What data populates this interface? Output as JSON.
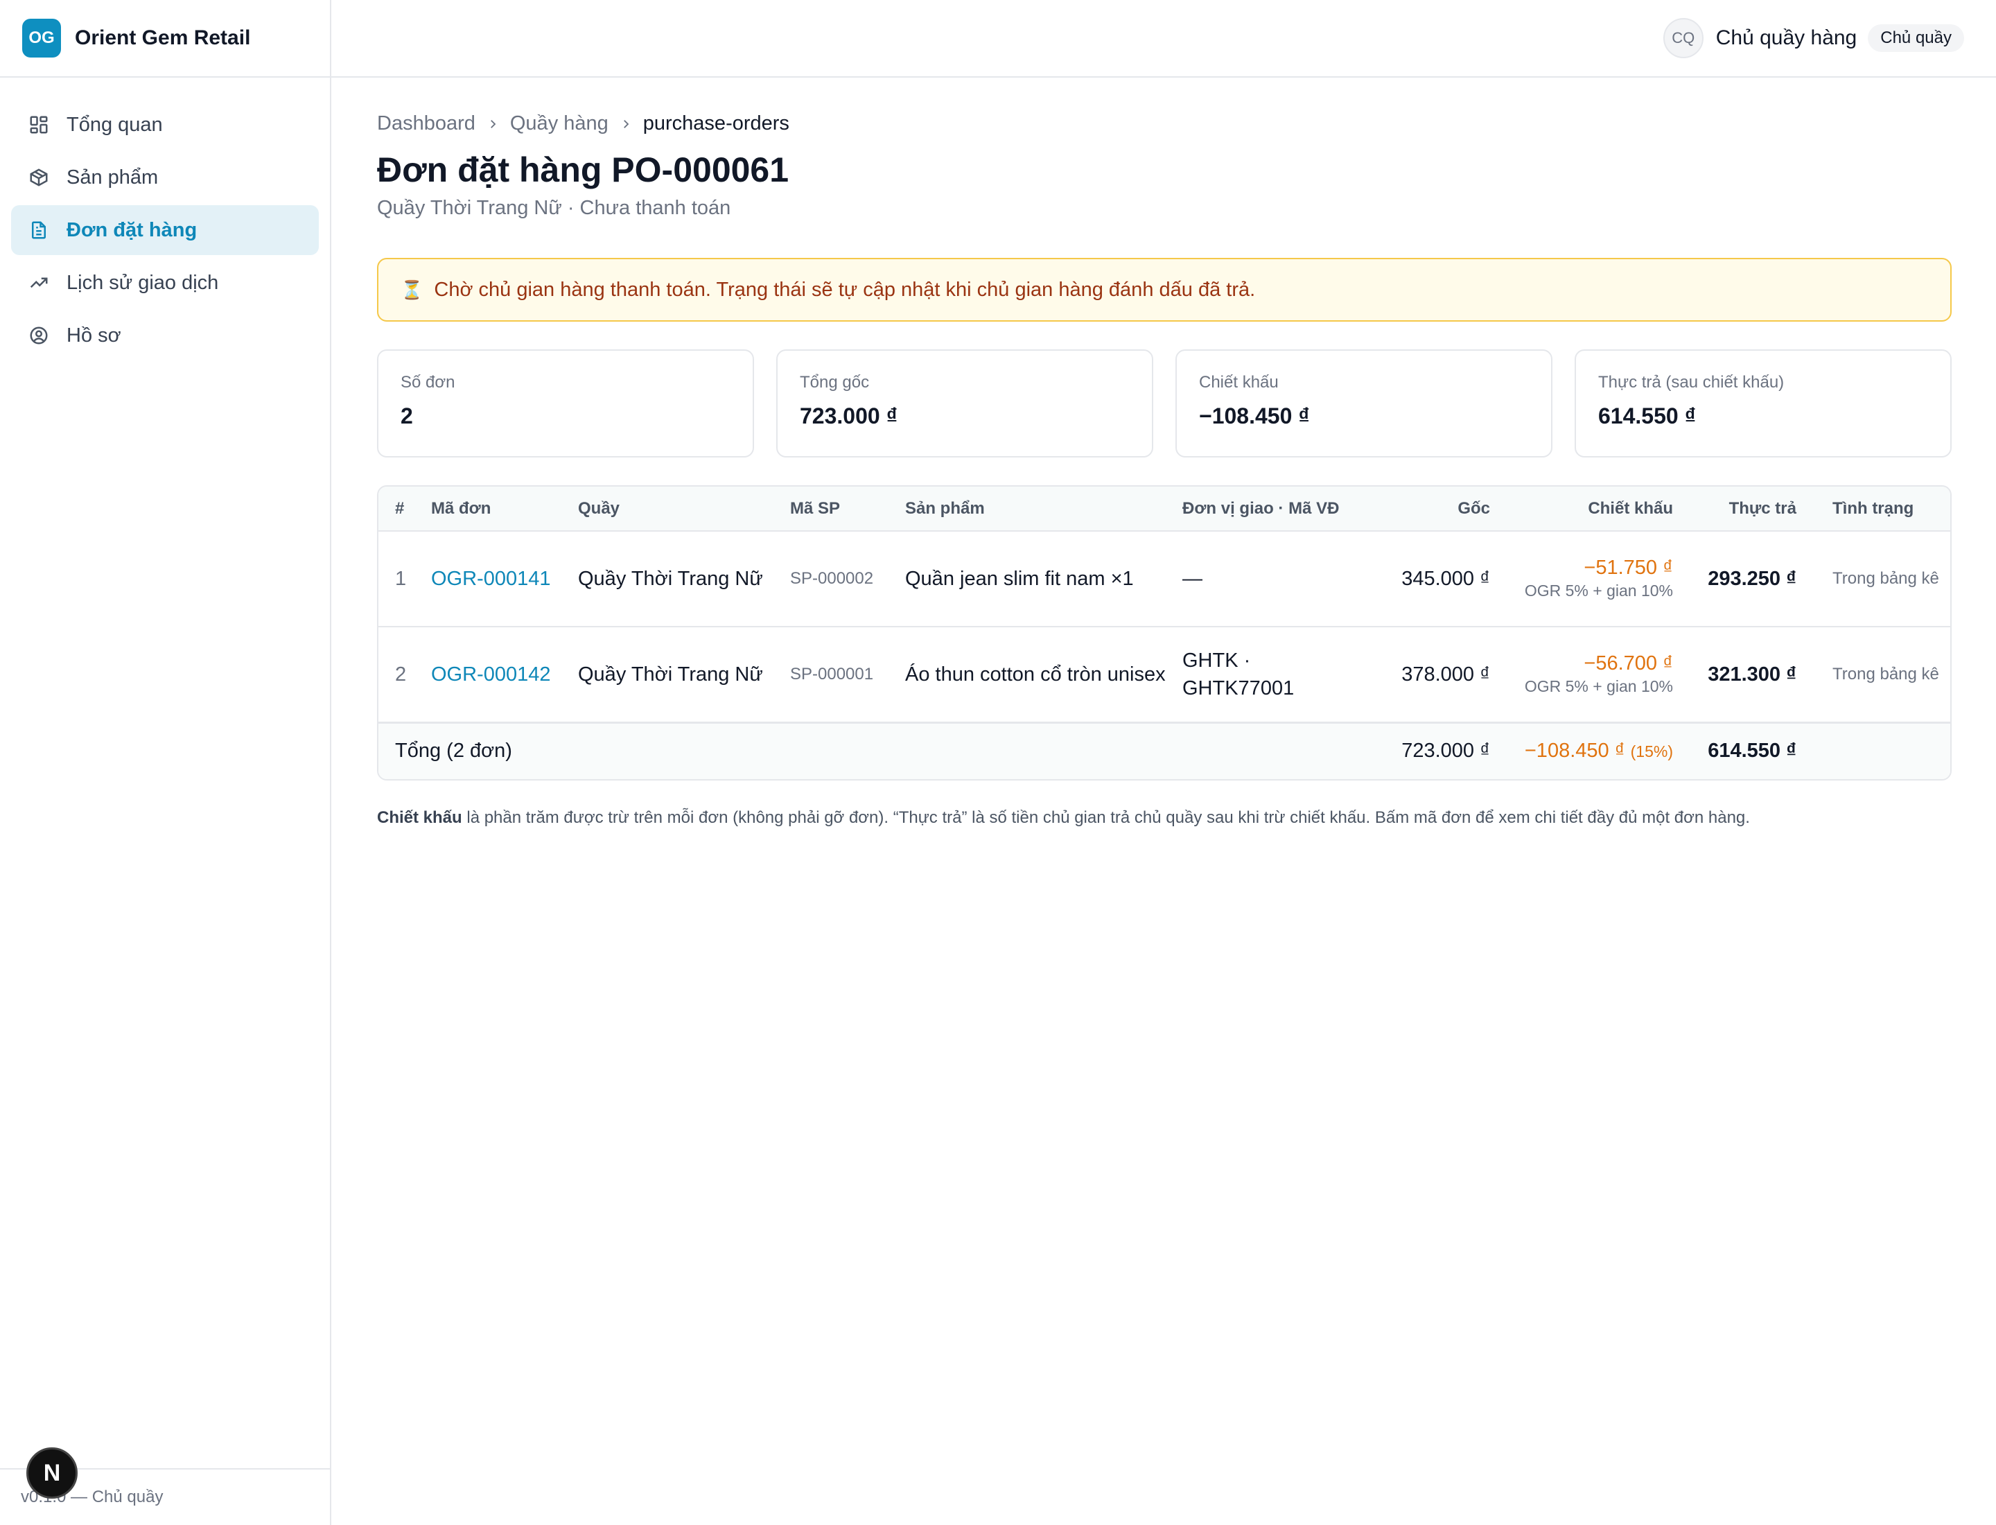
{
  "brand": {
    "logo": "OG",
    "name": "Orient Gem Retail"
  },
  "nav": {
    "items": [
      {
        "label": "Tổng quan",
        "icon": "grid-icon",
        "active": false
      },
      {
        "label": "Sản phẩm",
        "icon": "box-icon",
        "active": false
      },
      {
        "label": "Đơn đặt hàng",
        "icon": "document-icon",
        "active": true
      },
      {
        "label": "Lịch sử giao dịch",
        "icon": "trending-up-icon",
        "active": false
      },
      {
        "label": "Hồ sơ",
        "icon": "user-circle-icon",
        "active": false
      }
    ]
  },
  "sidebar_footer": "v0.1.0 — Chủ quầy",
  "next_badge": "N",
  "user": {
    "initials": "CQ",
    "name": "Chủ quầy hàng",
    "role": "Chủ quầy"
  },
  "breadcrumb": {
    "items": [
      "Dashboard",
      "Quầy hàng",
      "purchase-orders"
    ]
  },
  "page": {
    "title": "Đơn đặt hàng PO-000061",
    "subtitle": "Quầy Thời Trang Nữ · Chưa thanh toán"
  },
  "alert": {
    "icon": "⏳",
    "text": "Chờ chủ gian hàng thanh toán. Trạng thái sẽ tự cập nhật khi chủ gian hàng đánh dấu đã trả."
  },
  "stats": [
    {
      "label": "Số đơn",
      "value": "2"
    },
    {
      "label": "Tổng gốc",
      "value": "723.000 ₫"
    },
    {
      "label": "Chiết khấu",
      "value": "−108.450 ₫"
    },
    {
      "label": "Thực trả (sau chiết khấu)",
      "value": "614.550 ₫"
    }
  ],
  "table": {
    "headers": [
      "#",
      "Mã đơn",
      "Quầy",
      "Mã SP",
      "Sản phẩm",
      "Đơn vị giao · Mã VĐ",
      "Gốc",
      "Chiết khấu",
      "Thực trả",
      "Tình trạng"
    ],
    "rows": [
      {
        "idx": "1",
        "order": "OGR-000141",
        "counter": "Quầy Thời Trang Nữ",
        "sku": "SP-000002",
        "product": "Quần jean slim fit nam ×1",
        "shipping": "—",
        "original": "345.000 ₫",
        "discount": "−51.750 ₫",
        "discount_note": "OGR 5% + gian 10%",
        "paid": "293.250 ₫",
        "status": "Trong bảng kê"
      },
      {
        "idx": "2",
        "order": "OGR-000142",
        "counter": "Quầy Thời Trang Nữ",
        "sku": "SP-000001",
        "product": "Áo thun cotton cổ tròn unisex",
        "shipping": "GHTK · GHTK77001",
        "original": "378.000 ₫",
        "discount": "−56.700 ₫",
        "discount_note": "OGR 5% + gian 10%",
        "paid": "321.300 ₫",
        "status": "Trong bảng kê"
      }
    ],
    "total": {
      "label": "Tổng (2 đơn)",
      "original": "723.000 ₫",
      "discount": "−108.450 ₫",
      "discount_pct": "(15%)",
      "paid": "614.550 ₫"
    }
  },
  "footnote": {
    "bold": "Chiết khấu",
    "text": " là phần trăm được trừ trên mỗi đơn (không phải gỡ đơn). “Thực trả” là số tiền chủ gian trả chủ quầy sau khi trừ chiết khấu. Bấm mã đơn để xem chi tiết đầy đủ một đơn hàng."
  },
  "colors": {
    "accent": "#0e87b8",
    "discount": "#e0730f",
    "alert_bg": "#fffbea",
    "alert_border": "#f5c84a"
  }
}
